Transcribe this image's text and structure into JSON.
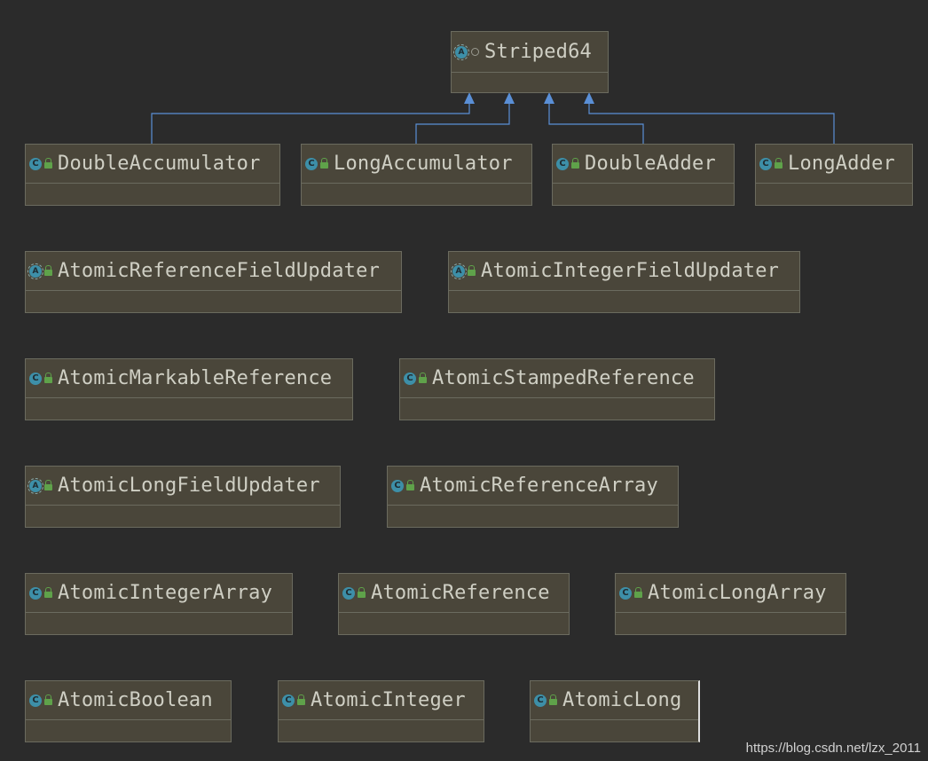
{
  "diagram": {
    "parent": {
      "name": "Striped64",
      "kind": "abstract",
      "visibility": "package"
    },
    "children_of_parent": [
      {
        "name": "DoubleAccumulator",
        "kind": "class"
      },
      {
        "name": "LongAccumulator",
        "kind": "class"
      },
      {
        "name": "DoubleAdder",
        "kind": "class"
      },
      {
        "name": "LongAdder",
        "kind": "class"
      }
    ],
    "other_classes": [
      {
        "name": "AtomicReferenceFieldUpdater",
        "kind": "abstract"
      },
      {
        "name": "AtomicIntegerFieldUpdater",
        "kind": "abstract"
      },
      {
        "name": "AtomicMarkableReference",
        "kind": "class"
      },
      {
        "name": "AtomicStampedReference",
        "kind": "class"
      },
      {
        "name": "AtomicLongFieldUpdater",
        "kind": "abstract"
      },
      {
        "name": "AtomicReferenceArray",
        "kind": "class"
      },
      {
        "name": "AtomicIntegerArray",
        "kind": "class"
      },
      {
        "name": "AtomicReference",
        "kind": "class"
      },
      {
        "name": "AtomicLongArray",
        "kind": "class"
      },
      {
        "name": "AtomicBoolean",
        "kind": "class"
      },
      {
        "name": "AtomicInteger",
        "kind": "class"
      },
      {
        "name": "AtomicLong",
        "kind": "class"
      }
    ],
    "edge_color": "#5a8fd6"
  },
  "icons": {
    "class": "C",
    "abstract": "A"
  },
  "watermark": "https://blog.csdn.net/lzx_2011"
}
